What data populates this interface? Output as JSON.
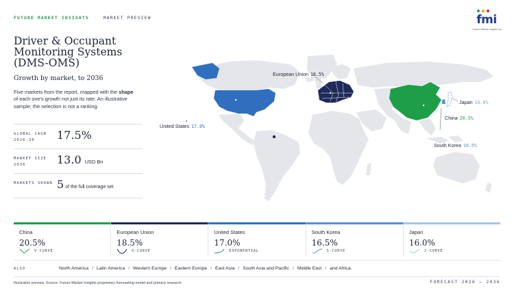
{
  "header": {
    "brand": "FUTURE MARKET INSIGHTS",
    "separator": "·",
    "section": "MARKET PREVIEW",
    "logo_text": "fmi",
    "logo_tagline": "Future Market Insights Inc."
  },
  "title": "Driver & Occupant Monitoring Systems (DMS-OMS)",
  "subtitle": "Growth by market, to 2036",
  "description": {
    "part1": "Five markets from the report, mapped with the ",
    "bold": "shape",
    "part2": " of each one's growth not just its rate. An illustrative sample; the selection is not a ranking."
  },
  "metrics": [
    {
      "label": "GLOBAL CAGR 2026-36",
      "value": "17.5%",
      "unit": ""
    },
    {
      "label": "MARKET SIZE 2036",
      "value": "13.0",
      "unit": "USD Bn"
    },
    {
      "label": "MARKETS SHOWN",
      "value": "5",
      "unit": "of the full coverage set"
    }
  ],
  "map_labels": [
    {
      "name": "European Union",
      "pct": "18.5%"
    },
    {
      "name": "United States",
      "pct": "17.0%"
    },
    {
      "name": "Japan",
      "pct": "16.0%"
    },
    {
      "name": "China",
      "pct": "20.5%"
    },
    {
      "name": "South Korea",
      "pct": "16.5%"
    }
  ],
  "cards": [
    {
      "name": "China",
      "value": "20.5%",
      "shape": "V-CURVE",
      "color": "#1e9e48"
    },
    {
      "name": "European Union",
      "value": "18.5%",
      "shape": "U-CURVE",
      "color": "#1e2a5a"
    },
    {
      "name": "United States",
      "value": "17.0%",
      "shape": "EXPONENTIAL",
      "color": "#2f6fbd"
    },
    {
      "name": "South Korea",
      "value": "16.5%",
      "shape": "S-CURVE",
      "color": "#5b8fd0"
    },
    {
      "name": "Japan",
      "value": "16.0%",
      "shape": "J-CURVE",
      "color": "#a9c4e6"
    }
  ],
  "also": {
    "label": "ALSO",
    "items": [
      "North America",
      "Latin America",
      "Western Europe",
      "Eastern Europe",
      "East Asia",
      "South Asia and Pacific",
      "Middle East",
      "and Africa."
    ],
    "separator": "/"
  },
  "footer": {
    "source": "Illustrative preview. Source: Future Market Insights proprietary forecasting model and primary research.",
    "forecast": "FORECAST 2026 – 2036"
  },
  "colors": {
    "china": "#1e9e48",
    "eu": "#1e2a5a",
    "us": "#2f6fbd",
    "south_korea": "#5b8fd0",
    "japan": "#a9c4e6",
    "land": "#e4e6ea"
  }
}
